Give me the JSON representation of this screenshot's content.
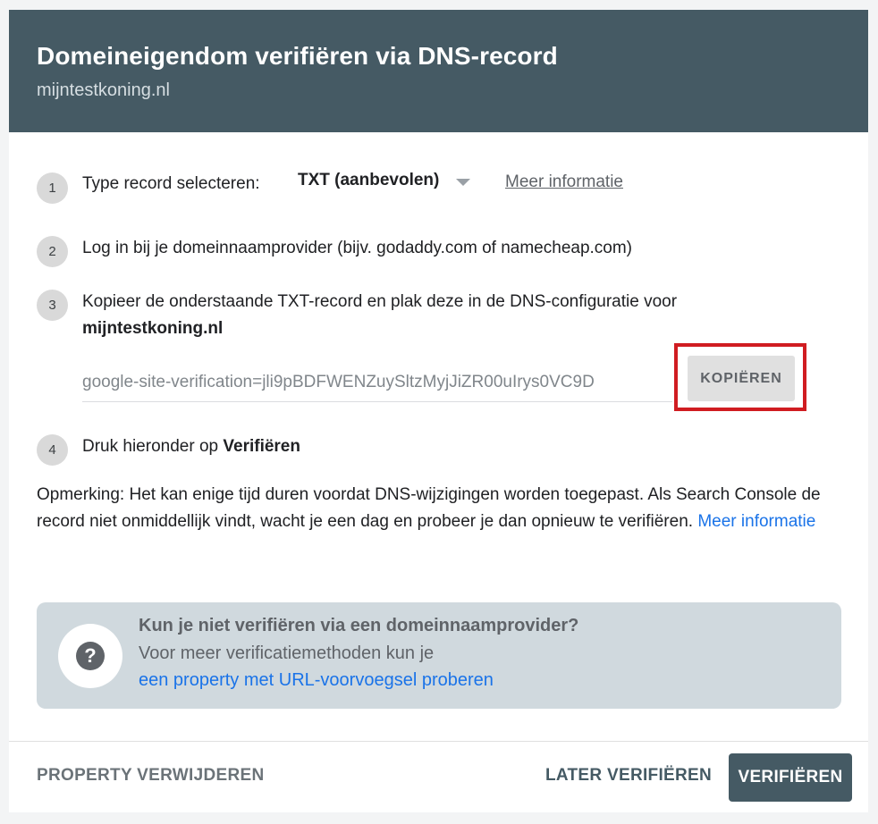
{
  "header": {
    "title": "Domeineigendom verifiëren via DNS-record",
    "domain": "mijntestkoning.nl"
  },
  "steps": [
    {
      "number": "1",
      "label": "Type record selecteren:",
      "select_value": "TXT (aanbevolen)",
      "link": "Meer informatie"
    },
    {
      "number": "2",
      "text": "Log in bij je domeinnaamprovider (bijv. godaddy.com of namecheap.com)"
    },
    {
      "number": "3",
      "text": "Kopieer de onderstaande TXT-record en plak deze in de DNS-configuratie voor",
      "domain": "mijntestkoning.nl",
      "record_value": "google-site-verification=jli9pBDFWENZuySltzMyjJiZR00uIrys0VC9D",
      "copy_label": "KOPIËREN"
    },
    {
      "number": "4",
      "text": "Druk hieronder op",
      "bold_text": "Verifiëren"
    }
  ],
  "note": {
    "text": "Opmerking: Het kan enige tijd duren voordat DNS-wijzigingen worden toegepast. Als Search Console de record niet onmiddellijk vindt, wacht je een dag en probeer je dan opnieuw te verifiëren.",
    "link": "Meer informatie"
  },
  "help": {
    "icon": "help-icon",
    "title": "Kun je niet verifiëren via een domeinnaamprovider?",
    "line": "Voor meer verificatiemethoden kun je",
    "link": "een property met URL-voorvoegsel proberen"
  },
  "footer": {
    "remove_label": "PROPERTY VERWIJDEREN",
    "later_label": "LATER VERIFIËREN",
    "verify_label": "VERIFIËREN"
  },
  "colors": {
    "header_bg": "#455a64",
    "link_blue": "#1a73e8",
    "highlight": "#d01c21",
    "help_bg": "#d0d9de"
  }
}
